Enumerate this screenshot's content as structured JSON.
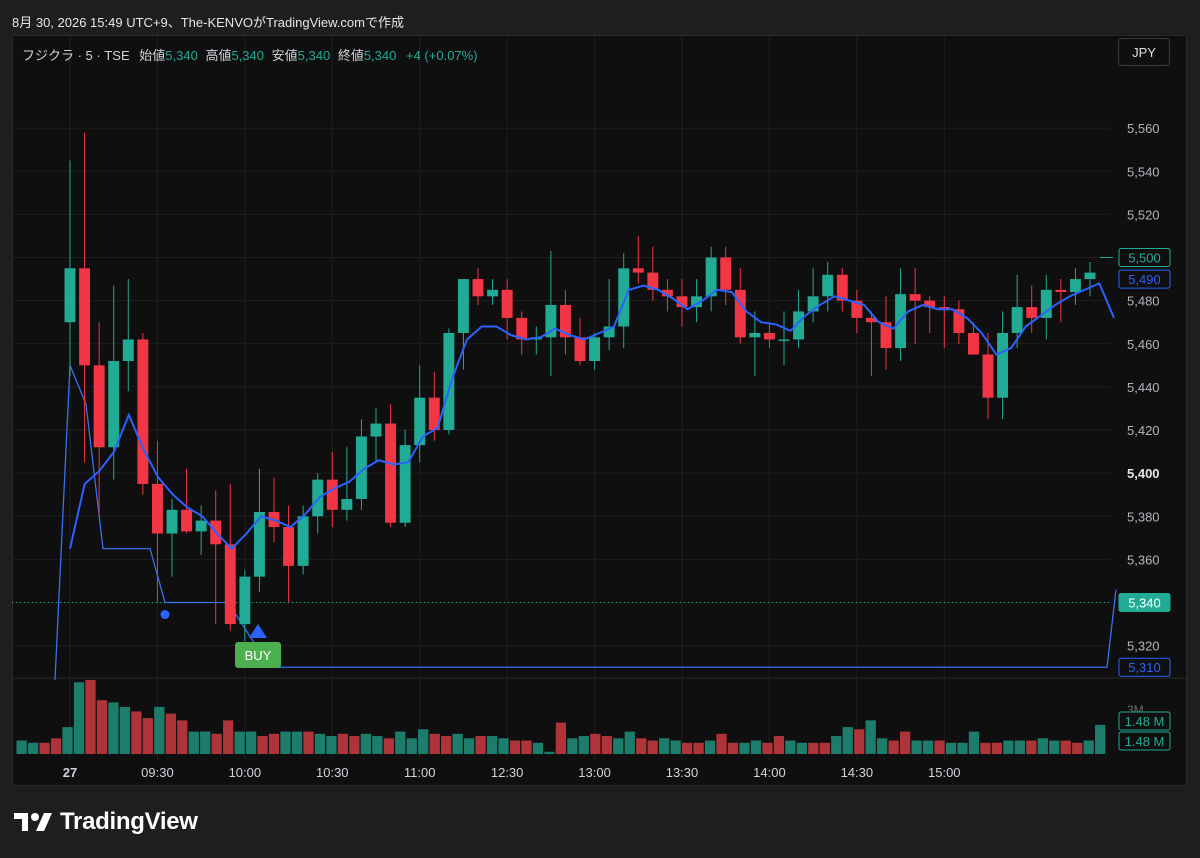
{
  "caption": "8月 30, 2026 15:49 UTC+9、The-KENVOがTradingView.comで作成",
  "legend": {
    "symbol": "フジクラ · 5 · TSE",
    "open_label": "始値",
    "open": "5,340",
    "high_label": "高値",
    "high": "5,340",
    "low_label": "安値",
    "low": "5,340",
    "close_label": "終値",
    "close": "5,340",
    "change": "+4 (+0.07%)"
  },
  "currency_button": "JPY",
  "brand": {
    "name": "TradingView",
    "icon": "tradingview-logo-icon"
  },
  "colors": {
    "up": "#22ab94",
    "down": "#f23645",
    "ma_line": "#2962ff",
    "signal_line": "#3a6ff0",
    "buy_label": "#4caf50",
    "background": "#0f0f0f"
  },
  "chart_data": {
    "type": "candlestick",
    "interval": "5",
    "ylim": [
      5305,
      5580
    ],
    "yticks": [
      5320,
      5340,
      5360,
      5380,
      5400,
      5420,
      5440,
      5460,
      5480,
      5500,
      5520,
      5540,
      5560
    ],
    "ytick_labels": [
      "5,320",
      "5,340",
      "5,360",
      "5,380",
      "5,400",
      "5,420",
      "5,440",
      "5,460",
      "5,480",
      "5,500",
      "5,520",
      "5,540",
      "5,560"
    ],
    "x_labels": [
      {
        "label": "27",
        "index": 0
      },
      {
        "label": "09:30",
        "index": 6
      },
      {
        "label": "10:00",
        "index": 12
      },
      {
        "label": "10:30",
        "index": 18
      },
      {
        "label": "11:00",
        "index": 24
      },
      {
        "label": "12:30",
        "index": 30
      },
      {
        "label": "13:00",
        "index": 36
      },
      {
        "label": "13:30",
        "index": 42
      },
      {
        "label": "14:00",
        "index": 48
      },
      {
        "label": "14:30",
        "index": 54
      },
      {
        "label": "15:00",
        "index": 60
      }
    ],
    "candles": [
      [
        5470,
        5545,
        5445,
        5495
      ],
      [
        5495,
        5558,
        5405,
        5450
      ],
      [
        5450,
        5470,
        5380,
        5412
      ],
      [
        5412,
        5487,
        5397,
        5452
      ],
      [
        5452,
        5490,
        5438,
        5462
      ],
      [
        5462,
        5465,
        5390,
        5395
      ],
      [
        5395,
        5415,
        5340,
        5372
      ],
      [
        5372,
        5388,
        5352,
        5383
      ],
      [
        5383,
        5402,
        5372,
        5373
      ],
      [
        5373,
        5385,
        5362,
        5378
      ],
      [
        5378,
        5392,
        5330,
        5367
      ],
      [
        5367,
        5395,
        5327,
        5330
      ],
      [
        5330,
        5355,
        5322,
        5352
      ],
      [
        5352,
        5402,
        5345,
        5382
      ],
      [
        5382,
        5398,
        5368,
        5375
      ],
      [
        5375,
        5385,
        5340,
        5357
      ],
      [
        5357,
        5385,
        5353,
        5380
      ],
      [
        5380,
        5400,
        5372,
        5397
      ],
      [
        5397,
        5410,
        5375,
        5383
      ],
      [
        5383,
        5412,
        5378,
        5388
      ],
      [
        5388,
        5425,
        5383,
        5417
      ],
      [
        5417,
        5430,
        5405,
        5423
      ],
      [
        5423,
        5432,
        5375,
        5377
      ],
      [
        5377,
        5420,
        5375,
        5413
      ],
      [
        5413,
        5450,
        5405,
        5435
      ],
      [
        5435,
        5447,
        5415,
        5420
      ],
      [
        5420,
        5467,
        5418,
        5465
      ],
      [
        5465,
        5490,
        5448,
        5490
      ],
      [
        5490,
        5495,
        5478,
        5482
      ],
      [
        5482,
        5490,
        5478,
        5485
      ],
      [
        5485,
        5490,
        5462,
        5472
      ],
      [
        5472,
        5475,
        5455,
        5462
      ],
      [
        5462,
        5468,
        5455,
        5463
      ],
      [
        5463,
        5503,
        5445,
        5478
      ],
      [
        5478,
        5485,
        5455,
        5463
      ],
      [
        5463,
        5472,
        5450,
        5452
      ],
      [
        5452,
        5465,
        5448,
        5463
      ],
      [
        5463,
        5490,
        5457,
        5468
      ],
      [
        5468,
        5502,
        5458,
        5495
      ],
      [
        5495,
        5510,
        5488,
        5493
      ],
      [
        5493,
        5505,
        5480,
        5485
      ],
      [
        5485,
        5490,
        5475,
        5482
      ],
      [
        5482,
        5490,
        5468,
        5477
      ],
      [
        5477,
        5490,
        5470,
        5482
      ],
      [
        5482,
        5505,
        5475,
        5500
      ],
      [
        5500,
        5505,
        5478,
        5485
      ],
      [
        5485,
        5495,
        5460,
        5463
      ],
      [
        5463,
        5475,
        5445,
        5465
      ],
      [
        5465,
        5470,
        5458,
        5462
      ],
      [
        5462,
        5475,
        5450,
        5462
      ],
      [
        5462,
        5485,
        5458,
        5475
      ],
      [
        5475,
        5495,
        5470,
        5482
      ],
      [
        5482,
        5498,
        5475,
        5492
      ],
      [
        5492,
        5495,
        5475,
        5480
      ],
      [
        5480,
        5485,
        5465,
        5472
      ],
      [
        5472,
        5475,
        5445,
        5470
      ],
      [
        5470,
        5482,
        5448,
        5458
      ],
      [
        5458,
        5495,
        5452,
        5483
      ],
      [
        5483,
        5495,
        5460,
        5480
      ],
      [
        5480,
        5482,
        5465,
        5477
      ],
      [
        5477,
        5482,
        5458,
        5476
      ],
      [
        5476,
        5480,
        5460,
        5465
      ],
      [
        5465,
        5470,
        5455,
        5455
      ],
      [
        5455,
        5465,
        5425,
        5435
      ],
      [
        5435,
        5475,
        5425,
        5465
      ],
      [
        5465,
        5492,
        5458,
        5477
      ],
      [
        5477,
        5487,
        5465,
        5472
      ],
      [
        5472,
        5492,
        5462,
        5485
      ],
      [
        5485,
        5490,
        5470,
        5484
      ],
      [
        5484,
        5495,
        5478,
        5490
      ],
      [
        5490,
        5498,
        5482,
        5493
      ]
    ],
    "ma_series": {
      "values": [
        5365,
        5395,
        5401,
        5410,
        5427,
        5411,
        5398,
        5390,
        5384,
        5380,
        5372,
        5365,
        5372,
        5380,
        5378,
        5375,
        5381,
        5389,
        5393,
        5396,
        5402,
        5406,
        5404,
        5405,
        5417,
        5421,
        5444,
        5462,
        5468,
        5468,
        5464,
        5462,
        5463,
        5467,
        5464,
        5462,
        5465,
        5468,
        5485,
        5487,
        5485,
        5481,
        5476,
        5480,
        5485,
        5484,
        5475,
        5470,
        5469,
        5466,
        5473,
        5478,
        5482,
        5480,
        5478,
        5470,
        5467,
        5475,
        5478,
        5476,
        5476,
        5472,
        5465,
        5455,
        5458,
        5468,
        5473,
        5478,
        5482,
        5485,
        5488,
        5472
      ]
    },
    "signal_series": {
      "values": [
        5304,
        5450,
        5432,
        5365,
        5365,
        5365,
        5340,
        5340,
        5340,
        5340,
        5310,
        5310
      ]
    },
    "buy_marker": {
      "index": 10,
      "label": "BUY"
    },
    "dot_marker": {
      "index": 6,
      "value": 5340
    },
    "last_price": {
      "value": 5340,
      "label": "5,340"
    },
    "price_tags": [
      {
        "value": 5500,
        "label": "5,500",
        "style": "outline-green"
      },
      {
        "value": 5490,
        "label": "5,490",
        "style": "outline-blue"
      },
      {
        "value": 5340,
        "label": "5,340",
        "style": "filled-green"
      },
      {
        "value": 5310,
        "label": "5,310",
        "style": "outline-blue"
      }
    ],
    "volume": {
      "ylim": [
        0,
        3.3
      ],
      "tick": "3M",
      "tags": [
        "1.48 M",
        "1.48 M"
      ],
      "values": [
        0.6,
        0.5,
        0.5,
        0.7,
        1.2,
        3.2,
        3.3,
        2.4,
        2.3,
        2.1,
        1.9,
        1.6,
        2.1,
        1.8,
        1.5,
        1.0,
        1.0,
        0.9,
        1.5,
        1.0,
        1.0,
        0.8,
        0.9,
        1.0,
        1.0,
        1.0,
        0.9,
        0.8,
        0.9,
        0.8,
        0.9,
        0.8,
        0.7,
        1.0,
        0.7,
        1.1,
        0.9,
        0.8,
        0.9,
        0.7,
        0.8,
        0.8,
        0.7,
        0.6,
        0.6,
        0.5,
        0.1,
        1.4,
        0.7,
        0.8,
        0.9,
        0.8,
        0.7,
        1.0,
        0.7,
        0.6,
        0.7,
        0.6,
        0.5,
        0.5,
        0.6,
        0.9,
        0.5,
        0.5,
        0.6,
        0.5,
        0.8,
        0.6,
        0.5,
        0.5,
        0.5,
        0.8,
        1.2,
        1.1,
        1.5,
        0.7,
        0.6,
        1.0,
        0.6,
        0.6,
        0.6,
        0.5,
        0.5,
        1.0,
        0.5,
        0.5,
        0.6,
        0.6,
        0.6,
        0.7,
        0.6,
        0.6,
        0.5,
        0.6,
        1.3
      ]
    }
  }
}
